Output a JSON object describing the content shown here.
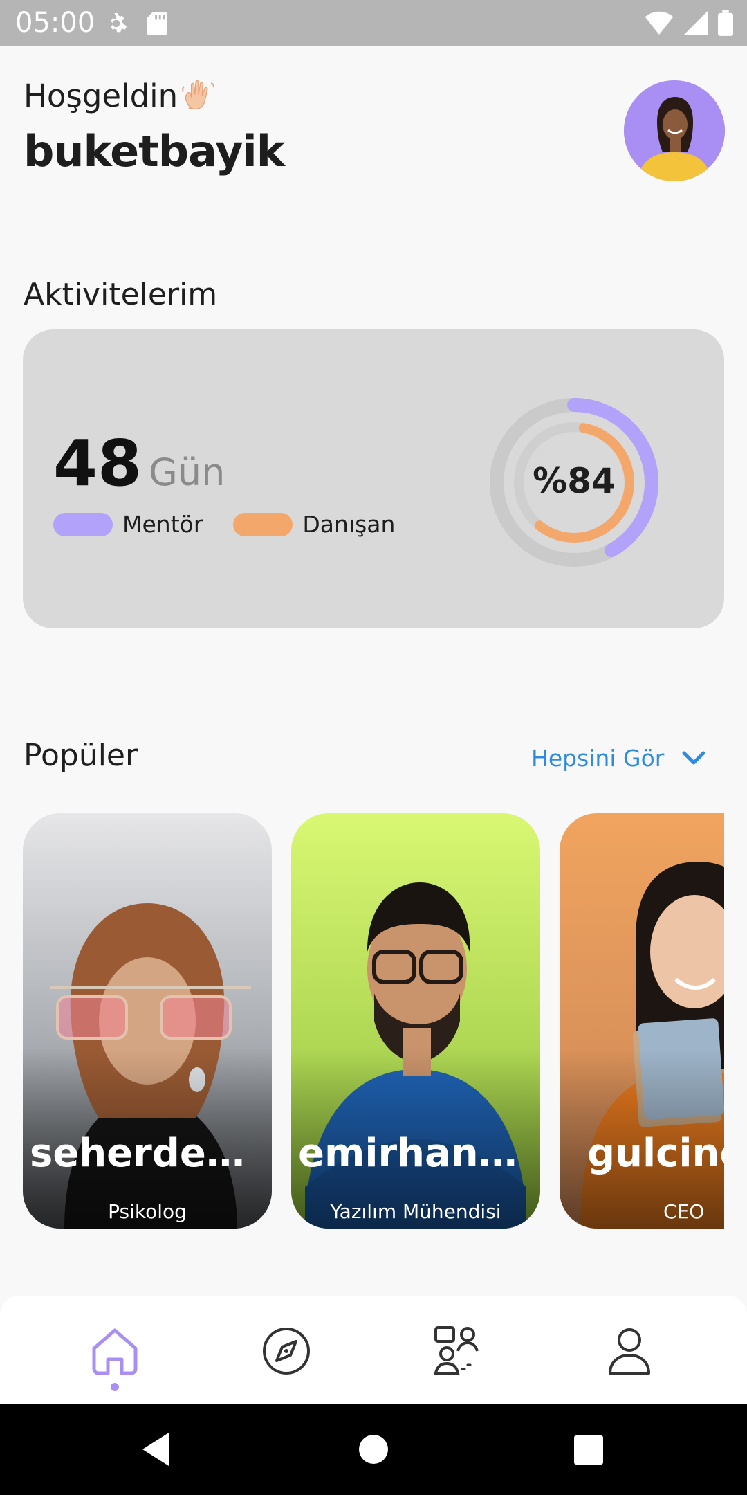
{
  "status_bar": {
    "time": "05:00"
  },
  "header": {
    "greeting": "Hoşgeldin",
    "username": "buketbayik"
  },
  "activities": {
    "title": "Aktivitelerim",
    "days_value": "48",
    "days_unit": "Gün",
    "legend": [
      {
        "label": "Mentör",
        "color": "#b3a2fa"
      },
      {
        "label": "Danışan",
        "color": "#f3a76a"
      }
    ],
    "percent_label": "%84",
    "progress": {
      "mentor_fraction": 0.42,
      "mentee_fraction": 0.58
    }
  },
  "popular": {
    "title": "Popüler",
    "see_all_label": "Hepsini Gör",
    "cards": [
      {
        "name": "seherdemir",
        "role": "Psikolog"
      },
      {
        "name": "emirhanyil...",
        "role": "Yazılım Mühendisi"
      },
      {
        "name": "gulcino",
        "role": "CEO"
      }
    ]
  },
  "colors": {
    "accent_purple": "#a98ff3",
    "accent_orange": "#f3a76a",
    "link_blue": "#2f8be0"
  },
  "bottom_nav": {
    "items": [
      {
        "icon": "home-icon",
        "active": true
      },
      {
        "icon": "compass-icon",
        "active": false
      },
      {
        "icon": "mentors-icon",
        "active": false
      },
      {
        "icon": "profile-icon",
        "active": false
      }
    ]
  }
}
